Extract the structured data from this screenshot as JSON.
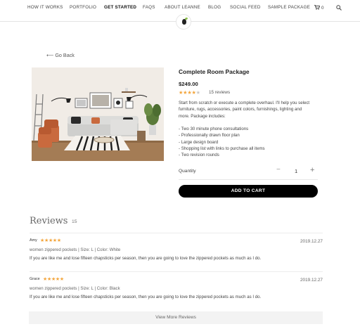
{
  "nav": {
    "items": [
      "HOW IT WORKS",
      "PORTFOLIO",
      "GET STARTED",
      "FAQS",
      "ABOUT LEANNE",
      "BLOG",
      "SOCIAL FEED",
      "SAMPLE PACKAGE"
    ],
    "cart_count": "0"
  },
  "back_label": "Go Back",
  "product": {
    "title": "Complete Room Package",
    "price": "$249.00",
    "rating": 4,
    "rating_max": 5,
    "review_count": "15 reviews",
    "description": [
      "Start from scratch or execute a complete overhaul. I'll help you select",
      "furniture, rugs, accessories, paint colors, furnishings, lighting and",
      "more. Package includes:",
      "",
      "- Two 30 minute phone consultations",
      "- Professionally drawn floor plan",
      "- Large design board",
      "- Shopping list with links to purchase all items",
      "- Two revision rounds"
    ],
    "quantity_label": "Quantity",
    "quantity": "1",
    "add_to_cart": "ADD TO CART"
  },
  "reviews": {
    "title": "Reviews",
    "count": "15",
    "items": [
      {
        "author": "Amy",
        "stars": 5,
        "date": "2019.12.27",
        "product": "women zippered pockets",
        "size": "Size: L",
        "color": "Color: White",
        "text": "If you are like me and lose fifteen chapsticks per season, then you are going to love the zippered pockets as much as I do."
      },
      {
        "author": "Grace",
        "stars": 5,
        "date": "2019.12.27",
        "product": "women zippered pockets",
        "size": "Size: L",
        "color": "Color: Black",
        "text": "If you are like me and lose fifteen chapsticks per season, then you are going to love the zippered pockets as much as I do."
      }
    ],
    "more_label": "View More Reviews"
  },
  "colors": {
    "star": "#f3a53b",
    "button": "#000000",
    "wall": "#f1ece6",
    "floor": "#a47c55",
    "chair": "#c96a3e"
  }
}
